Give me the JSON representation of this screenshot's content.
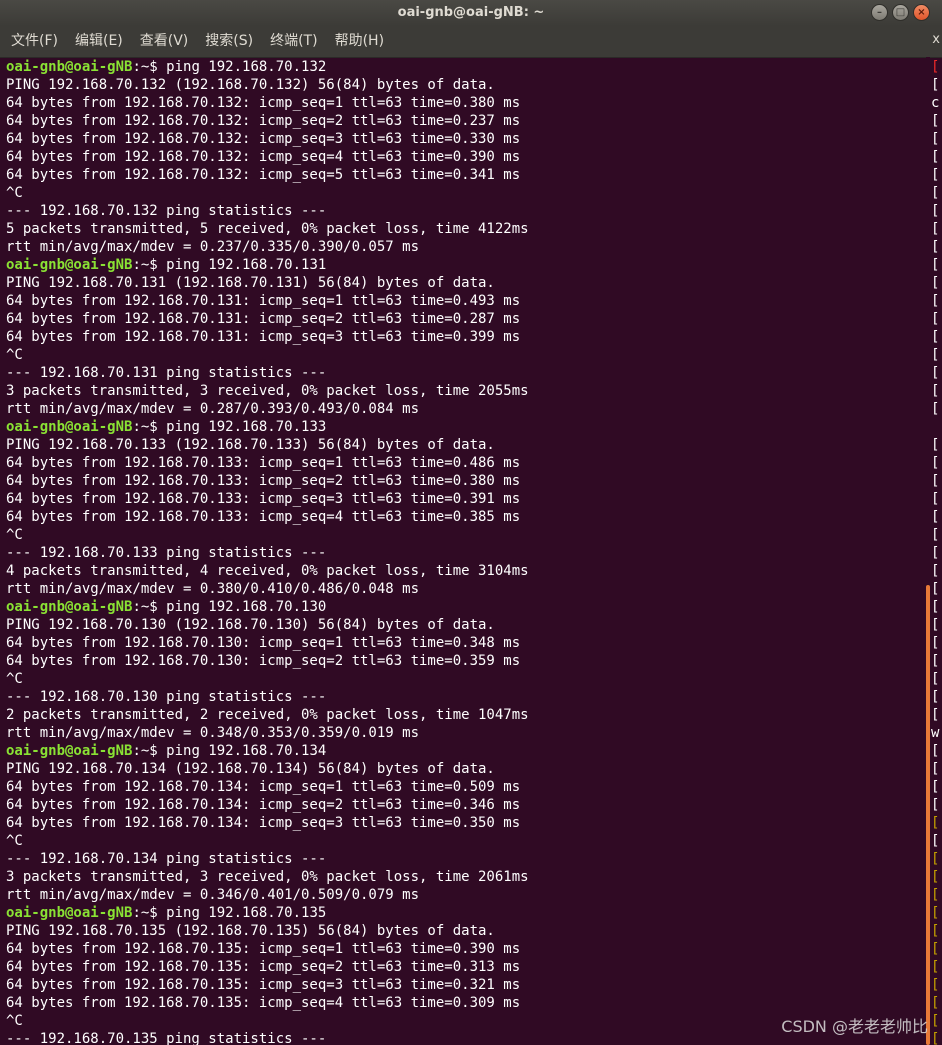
{
  "window": {
    "title": "oai-gnb@oai-gNB: ~",
    "buttons": [
      "–",
      "□",
      "×"
    ]
  },
  "menubar": {
    "items": [
      "文件(F)",
      "编辑(E)",
      "查看(V)",
      "搜索(S)",
      "终端(T)",
      "帮助(H)"
    ],
    "close_glyph": "x"
  },
  "terminal": {
    "prompt": "oai-gnb@oai-gNB",
    "prompt_suffix": ":~$ ",
    "lines": [
      {
        "type": "cmd",
        "text": "ping 192.168.70.132"
      },
      {
        "type": "out",
        "text": "PING 192.168.70.132 (192.168.70.132) 56(84) bytes of data."
      },
      {
        "type": "out",
        "text": "64 bytes from 192.168.70.132: icmp_seq=1 ttl=63 time=0.380 ms"
      },
      {
        "type": "out",
        "text": "64 bytes from 192.168.70.132: icmp_seq=2 ttl=63 time=0.237 ms"
      },
      {
        "type": "out",
        "text": "64 bytes from 192.168.70.132: icmp_seq=3 ttl=63 time=0.330 ms"
      },
      {
        "type": "out",
        "text": "64 bytes from 192.168.70.132: icmp_seq=4 ttl=63 time=0.390 ms"
      },
      {
        "type": "out",
        "text": "64 bytes from 192.168.70.132: icmp_seq=5 ttl=63 time=0.341 ms"
      },
      {
        "type": "out",
        "text": "^C"
      },
      {
        "type": "out",
        "text": "--- 192.168.70.132 ping statistics ---"
      },
      {
        "type": "out",
        "text": "5 packets transmitted, 5 received, 0% packet loss, time 4122ms"
      },
      {
        "type": "out",
        "text": "rtt min/avg/max/mdev = 0.237/0.335/0.390/0.057 ms"
      },
      {
        "type": "cmd",
        "text": "ping 192.168.70.131"
      },
      {
        "type": "out",
        "text": "PING 192.168.70.131 (192.168.70.131) 56(84) bytes of data."
      },
      {
        "type": "out",
        "text": "64 bytes from 192.168.70.131: icmp_seq=1 ttl=63 time=0.493 ms"
      },
      {
        "type": "out",
        "text": "64 bytes from 192.168.70.131: icmp_seq=2 ttl=63 time=0.287 ms"
      },
      {
        "type": "out",
        "text": "64 bytes from 192.168.70.131: icmp_seq=3 ttl=63 time=0.399 ms"
      },
      {
        "type": "out",
        "text": "^C"
      },
      {
        "type": "out",
        "text": "--- 192.168.70.131 ping statistics ---"
      },
      {
        "type": "out",
        "text": "3 packets transmitted, 3 received, 0% packet loss, time 2055ms"
      },
      {
        "type": "out",
        "text": "rtt min/avg/max/mdev = 0.287/0.393/0.493/0.084 ms"
      },
      {
        "type": "cmd",
        "text": "ping 192.168.70.133"
      },
      {
        "type": "out",
        "text": "PING 192.168.70.133 (192.168.70.133) 56(84) bytes of data."
      },
      {
        "type": "out",
        "text": "64 bytes from 192.168.70.133: icmp_seq=1 ttl=63 time=0.486 ms"
      },
      {
        "type": "out",
        "text": "64 bytes from 192.168.70.133: icmp_seq=2 ttl=63 time=0.380 ms"
      },
      {
        "type": "out",
        "text": "64 bytes from 192.168.70.133: icmp_seq=3 ttl=63 time=0.391 ms"
      },
      {
        "type": "out",
        "text": "64 bytes from 192.168.70.133: icmp_seq=4 ttl=63 time=0.385 ms"
      },
      {
        "type": "out",
        "text": "^C"
      },
      {
        "type": "out",
        "text": "--- 192.168.70.133 ping statistics ---"
      },
      {
        "type": "out",
        "text": "4 packets transmitted, 4 received, 0% packet loss, time 3104ms"
      },
      {
        "type": "out",
        "text": "rtt min/avg/max/mdev = 0.380/0.410/0.486/0.048 ms"
      },
      {
        "type": "cmd",
        "text": "ping 192.168.70.130"
      },
      {
        "type": "out",
        "text": "PING 192.168.70.130 (192.168.70.130) 56(84) bytes of data."
      },
      {
        "type": "out",
        "text": "64 bytes from 192.168.70.130: icmp_seq=1 ttl=63 time=0.348 ms"
      },
      {
        "type": "out",
        "text": "64 bytes from 192.168.70.130: icmp_seq=2 ttl=63 time=0.359 ms"
      },
      {
        "type": "out",
        "text": "^C"
      },
      {
        "type": "out",
        "text": "--- 192.168.70.130 ping statistics ---"
      },
      {
        "type": "out",
        "text": "2 packets transmitted, 2 received, 0% packet loss, time 1047ms"
      },
      {
        "type": "out",
        "text": "rtt min/avg/max/mdev = 0.348/0.353/0.359/0.019 ms"
      },
      {
        "type": "cmd",
        "text": "ping 192.168.70.134"
      },
      {
        "type": "out",
        "text": "PING 192.168.70.134 (192.168.70.134) 56(84) bytes of data."
      },
      {
        "type": "out",
        "text": "64 bytes from 192.168.70.134: icmp_seq=1 ttl=63 time=0.509 ms"
      },
      {
        "type": "out",
        "text": "64 bytes from 192.168.70.134: icmp_seq=2 ttl=63 time=0.346 ms"
      },
      {
        "type": "out",
        "text": "64 bytes from 192.168.70.134: icmp_seq=3 ttl=63 time=0.350 ms"
      },
      {
        "type": "out",
        "text": "^C"
      },
      {
        "type": "out",
        "text": "--- 192.168.70.134 ping statistics ---"
      },
      {
        "type": "out",
        "text": "3 packets transmitted, 3 received, 0% packet loss, time 2061ms"
      },
      {
        "type": "out",
        "text": "rtt min/avg/max/mdev = 0.346/0.401/0.509/0.079 ms"
      },
      {
        "type": "cmd",
        "text": "ping 192.168.70.135"
      },
      {
        "type": "out",
        "text": "PING 192.168.70.135 (192.168.70.135) 56(84) bytes of data."
      },
      {
        "type": "out",
        "text": "64 bytes from 192.168.70.135: icmp_seq=1 ttl=63 time=0.390 ms"
      },
      {
        "type": "out",
        "text": "64 bytes from 192.168.70.135: icmp_seq=2 ttl=63 time=0.313 ms"
      },
      {
        "type": "out",
        "text": "64 bytes from 192.168.70.135: icmp_seq=3 ttl=63 time=0.321 ms"
      },
      {
        "type": "out",
        "text": "64 bytes from 192.168.70.135: icmp_seq=4 ttl=63 time=0.309 ms"
      },
      {
        "type": "out",
        "text": "^C"
      },
      {
        "type": "out",
        "text": "--- 192.168.70.135 ping statistics ---"
      }
    ]
  },
  "side_strip": [
    {
      "text": "[",
      "color": "red"
    },
    {
      "text": "[",
      "color": "white"
    },
    {
      "text": "c",
      "color": "white"
    },
    {
      "text": "[",
      "color": "white"
    },
    {
      "text": "[",
      "color": "white"
    },
    {
      "text": "[",
      "color": "white"
    },
    {
      "text": "[",
      "color": "white"
    },
    {
      "text": "[",
      "color": "white"
    },
    {
      "text": "[",
      "color": "white"
    },
    {
      "text": "[",
      "color": "white"
    },
    {
      "text": "[",
      "color": "white"
    },
    {
      "text": "[",
      "color": "white"
    },
    {
      "text": "[",
      "color": "white"
    },
    {
      "text": "[",
      "color": "white"
    },
    {
      "text": "[",
      "color": "white"
    },
    {
      "text": "[",
      "color": "white"
    },
    {
      "text": "[",
      "color": "white"
    },
    {
      "text": "[",
      "color": "white"
    },
    {
      "text": "[",
      "color": "white"
    },
    {
      "text": "[",
      "color": "white"
    },
    {
      "text": "",
      "color": "white"
    },
    {
      "text": "[",
      "color": "white"
    },
    {
      "text": "[",
      "color": "white"
    },
    {
      "text": "[",
      "color": "white"
    },
    {
      "text": "[",
      "color": "white"
    },
    {
      "text": "[",
      "color": "white"
    },
    {
      "text": "[",
      "color": "white"
    },
    {
      "text": "[",
      "color": "white"
    },
    {
      "text": "[",
      "color": "white"
    },
    {
      "text": "[",
      "color": "white"
    },
    {
      "text": "[",
      "color": "white"
    },
    {
      "text": "[",
      "color": "white"
    },
    {
      "text": "[",
      "color": "white"
    },
    {
      "text": "[",
      "color": "white"
    },
    {
      "text": "[",
      "color": "white"
    },
    {
      "text": "[",
      "color": "white"
    },
    {
      "text": "[",
      "color": "white"
    },
    {
      "text": "w",
      "color": "white"
    },
    {
      "text": "[",
      "color": "white"
    },
    {
      "text": "[",
      "color": "white"
    },
    {
      "text": "[",
      "color": "white"
    },
    {
      "text": "[",
      "color": "white"
    },
    {
      "text": "[",
      "color": "yellow"
    },
    {
      "text": "[",
      "color": "white"
    },
    {
      "text": "[",
      "color": "yellow"
    },
    {
      "text": "[",
      "color": "yellow"
    },
    {
      "text": "[",
      "color": "yellow"
    },
    {
      "text": "[",
      "color": "yellow"
    },
    {
      "text": "[",
      "color": "yellow"
    },
    {
      "text": "[",
      "color": "yellow"
    },
    {
      "text": "[",
      "color": "yellow"
    },
    {
      "text": "[",
      "color": "yellow"
    },
    {
      "text": "[",
      "color": "yellow"
    },
    {
      "text": "[",
      "color": "yellow"
    },
    {
      "text": "[",
      "color": "yellow"
    }
  ],
  "watermark": "CSDN @老老老帅比",
  "colors": {
    "background": "#300a24",
    "prompt": "#8ae234",
    "text": "#ffffff",
    "scrollbar": "#e87a38"
  }
}
